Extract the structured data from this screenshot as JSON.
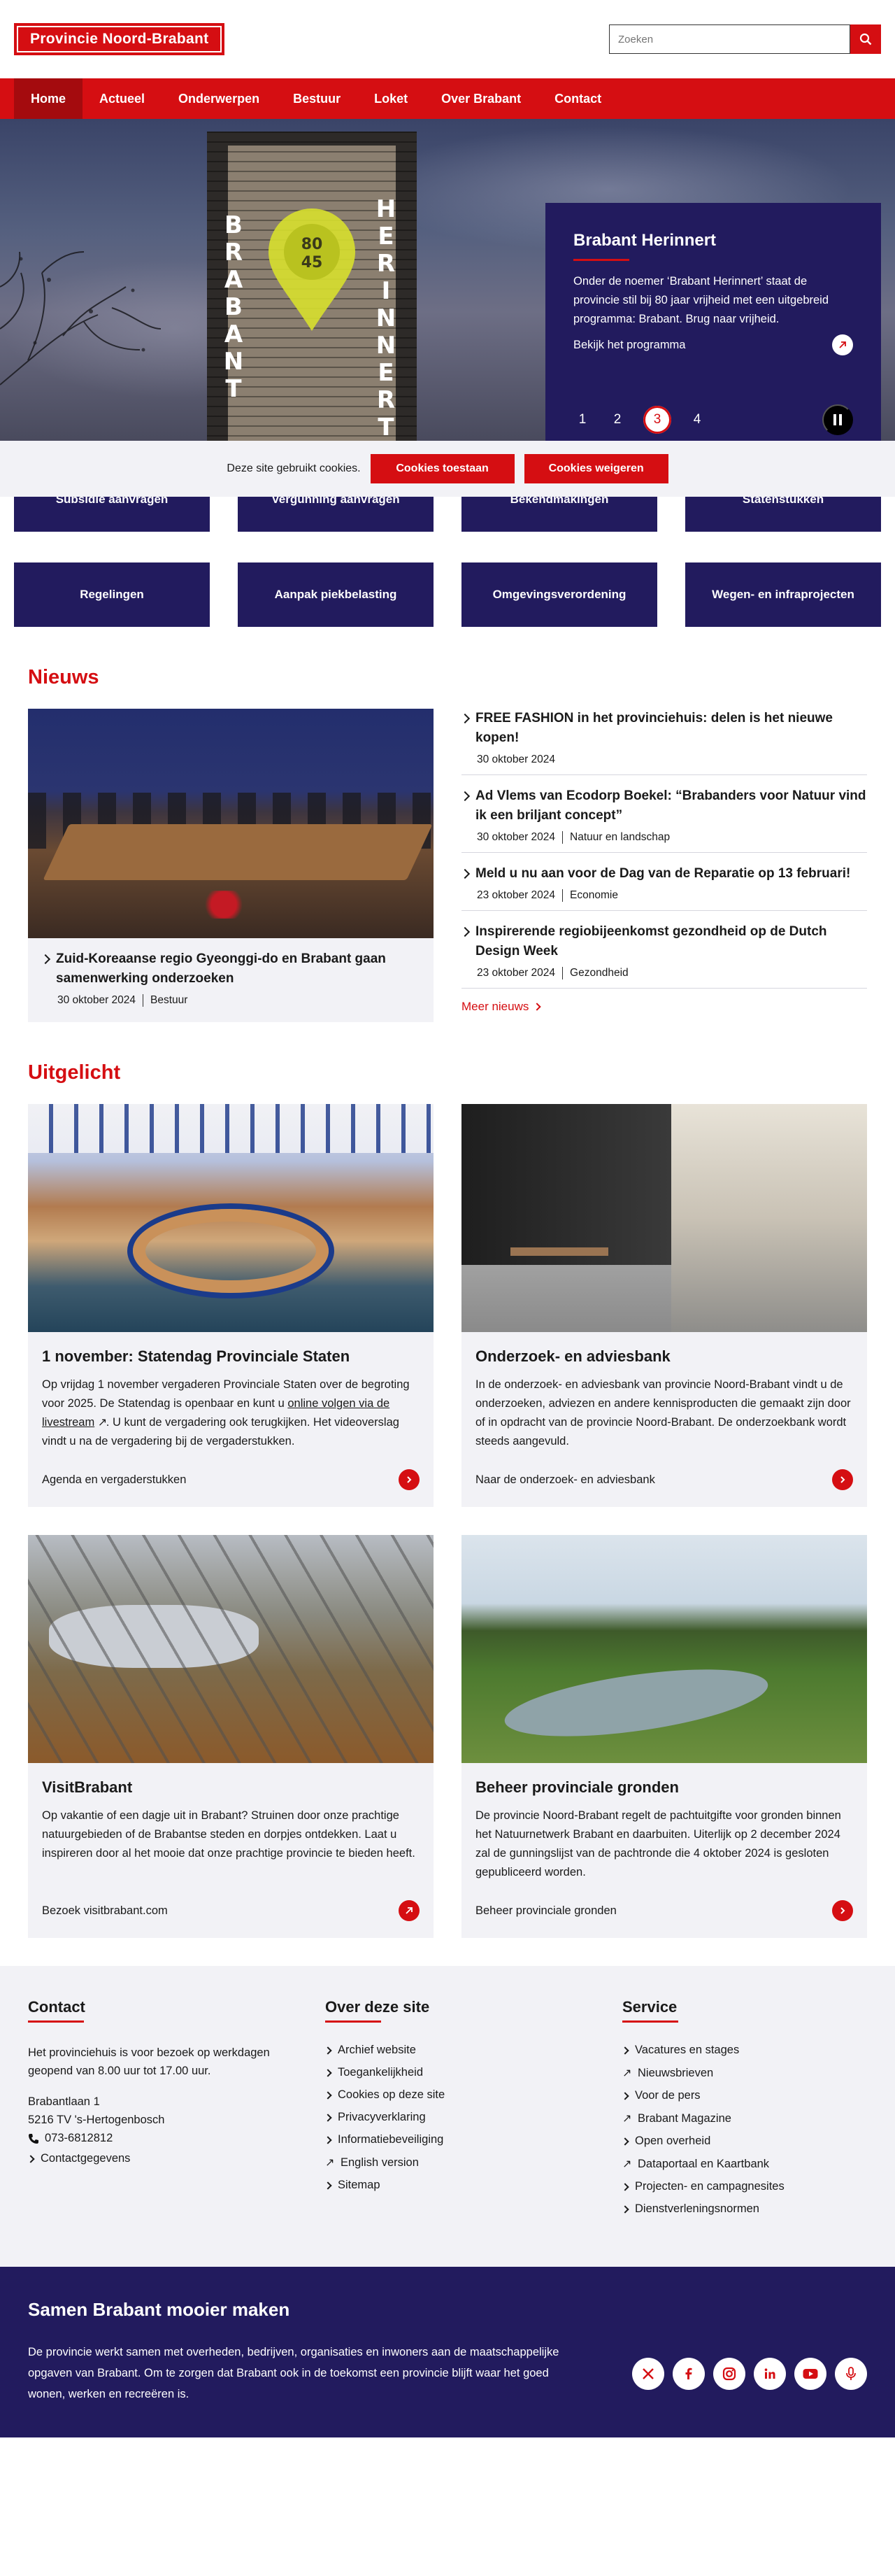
{
  "header": {
    "logo_text": "Provincie Noord-Brabant",
    "search_placeholder": "Zoeken"
  },
  "nav": [
    {
      "label": "Home",
      "active": true
    },
    {
      "label": "Actueel"
    },
    {
      "label": "Onderwerpen"
    },
    {
      "label": "Bestuur"
    },
    {
      "label": "Loket"
    },
    {
      "label": "Over Brabant"
    },
    {
      "label": "Contact"
    }
  ],
  "hero": {
    "tower_left": "BRABANT",
    "tower_right": "HERINNERT",
    "pin_text_1": "80",
    "pin_text_2": "45",
    "title": "Brabant Herinnert",
    "text": "Onder de noemer ‘Brabant Herinnert’ staat de provincie stil bij 80 jaar vrijheid met een uitgebreid programma: Brabant. Brug naar vrijheid.",
    "link": "Bekijk het programma",
    "pages": [
      "1",
      "2",
      "3",
      "4"
    ],
    "active_page": 3
  },
  "cookie": {
    "text": "Deze site gebruikt cookies.",
    "accept": "Cookies toestaan",
    "decline": "Cookies weigeren"
  },
  "tiles": {
    "row1": [
      "Subsidie aanvragen",
      "Vergunning aanvragen",
      "Bekendmakingen",
      "Statenstukken"
    ],
    "row2": [
      "Regelingen",
      "Aanpak piekbelasting",
      "Omgevingsverordening",
      "Wegen- en infraprojecten"
    ]
  },
  "news": {
    "heading": "Nieuws",
    "feature": {
      "title": "Zuid-Koreaanse regio Gyeonggi-do en Brabant gaan samenwerking onderzoeken",
      "date": "30 oktober 2024",
      "tag": "Bestuur"
    },
    "items": [
      {
        "title": "FREE FASHION in het provinciehuis: delen is het nieuwe kopen!",
        "date": "30 oktober 2024",
        "tag": ""
      },
      {
        "title": "Ad Vlems van Ecodorp Boekel: “Brabanders voor Natuur vind ik een briljant concept”",
        "date": "30 oktober 2024",
        "tag": "Natuur en landschap"
      },
      {
        "title": "Meld u nu aan voor de Dag van de Reparatie op 13 februari!",
        "date": "23 oktober 2024",
        "tag": "Economie"
      },
      {
        "title": "Inspirerende regiobijeenkomst gezondheid op de Dutch Design Week",
        "date": "23 oktober 2024",
        "tag": "Gezondheid"
      }
    ],
    "more": "Meer nieuws"
  },
  "featured": {
    "heading": "Uitgelicht",
    "cards": [
      {
        "title": "1 november: Statendag Provinciale Staten",
        "text_before": "Op vrijdag 1 november vergaderen Provinciale Staten over de begroting voor 2025. De Statendag is openbaar en kunt u ",
        "text_link": "online volgen via de livestream",
        "text_after": ". U kunt de vergadering ook terugkijken. Het videoverslag vindt u na de vergadering bij de vergaderstukken.",
        "link": "Agenda en vergaderstukken"
      },
      {
        "title": "Onderzoek- en adviesbank",
        "text": "In de onderzoek- en adviesbank van provincie Noord-Brabant vindt u de onderzoeken, adviezen en andere kennisproducten die gemaakt zijn door of in opdracht van de provincie Noord-Brabant. De onderzoekbank wordt steeds aangevuld.",
        "link": "Naar de onderzoek- en adviesbank"
      },
      {
        "title": "VisitBrabant",
        "text": "Op vakantie of een dagje uit in Brabant? Struinen door onze prachtige natuurgebieden of de Brabantse steden en dorpjes ontdekken. Laat u inspireren door al het mooie dat onze prachtige provincie te bieden heeft.",
        "link": "Bezoek visitbrabant.com"
      },
      {
        "title": "Beheer provinciale gronden",
        "text": "De provincie Noord-Brabant regelt de pachtuitgifte voor gronden binnen het Natuurnetwerk Brabant en daarbuiten. Uiterlijk op 2 december 2024 zal de gunningslijst van de pachtronde die 4 oktober 2024 is gesloten gepubliceerd worden.",
        "link": "Beheer provinciale gronden"
      }
    ]
  },
  "footer": {
    "contact": {
      "heading": "Contact",
      "line1": "Het provinciehuis is voor bezoek op werkdagen",
      "line2": "geopend van 8.00 uur tot 17.00 uur.",
      "addr1": "Brabantlaan 1",
      "addr2": "5216 TV 's-Hertogenbosch",
      "phone": "073-6812812",
      "details": "Contactgegevens"
    },
    "about": {
      "heading": "Over deze site",
      "links": [
        "Archief website",
        "Toegankelijkheid",
        "Cookies op deze site",
        "Privacyverklaring",
        "Informatiebeveiliging",
        "English version",
        "Sitemap"
      ]
    },
    "service": {
      "heading": "Service",
      "links": [
        "Vacatures en stages",
        "Nieuwsbrieven",
        "Voor de pers",
        "Brabant Magazine",
        "Open overheid",
        "Dataportaal en Kaartbank",
        "Projecten- en campagnesites",
        "Dienstverleningsnormen"
      ]
    }
  },
  "bottom": {
    "heading": "Samen Brabant mooier maken",
    "text": "De provincie werkt samen met overheden, bedrijven, organisaties en inwoners aan de maatschappelijke opgaven van Brabant. Om te zorgen dat Brabant ook in de toekomst een provincie blijft waar het goed wonen, werken en recreëren is.",
    "socials": [
      "x-icon",
      "facebook-icon",
      "instagram-icon",
      "linkedin-icon",
      "youtube-icon",
      "podcast-icon"
    ]
  },
  "colors": {
    "brand_red": "#d50e12",
    "brand_navy": "#221b5e",
    "light_bg": "#f2f2f6"
  }
}
